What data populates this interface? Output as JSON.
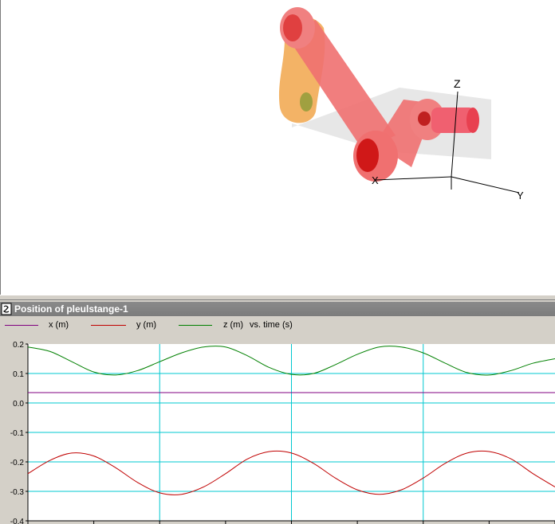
{
  "plot_window": {
    "title": "Position of pleulstange-1",
    "legend": [
      {
        "label": "x (m)",
        "color": "#800080"
      },
      {
        "label": "y (m)",
        "color": "#c00000"
      },
      {
        "label": "z (m)",
        "color": "#008000"
      }
    ],
    "legend_suffix": "vs. time (s)"
  },
  "viewport": {
    "axis_labels": {
      "z": "Z",
      "y": "Y",
      "x": "X"
    }
  },
  "chart_data": {
    "type": "line",
    "xlabel": "time (s)",
    "ylim": [
      -0.4,
      0.2
    ],
    "yticks": [
      "0.2",
      "0.1",
      "0.0",
      "-0.1",
      "-0.2",
      "-0.3",
      "-0.4"
    ],
    "ytick_values": [
      0.2,
      0.1,
      0.0,
      -0.1,
      -0.2,
      -0.3,
      -0.4
    ],
    "grid": true,
    "series": [
      {
        "name": "x (m)",
        "color": "#800080",
        "x": [
          0,
          1,
          2,
          3,
          4,
          5,
          6,
          7,
          8,
          9,
          10,
          11,
          12
        ],
        "values": [
          0.035,
          0.035,
          0.035,
          0.035,
          0.035,
          0.035,
          0.035,
          0.035,
          0.035,
          0.035,
          0.035,
          0.035,
          0.035
        ]
      },
      {
        "name": "y (m)",
        "color": "#c00000",
        "x": [
          0,
          0.5,
          1,
          1.5,
          2,
          2.5,
          3,
          3.5,
          4,
          4.5,
          5,
          5.5,
          6,
          6.5,
          7,
          7.5,
          8,
          8.5,
          9,
          9.5,
          10,
          10.5,
          11,
          11.5,
          12
        ],
        "values": [
          -0.24,
          -0.195,
          -0.17,
          -0.18,
          -0.22,
          -0.27,
          -0.305,
          -0.31,
          -0.285,
          -0.24,
          -0.19,
          -0.165,
          -0.17,
          -0.205,
          -0.255,
          -0.295,
          -0.31,
          -0.295,
          -0.255,
          -0.205,
          -0.17,
          -0.165,
          -0.19,
          -0.24,
          -0.285
        ]
      },
      {
        "name": "z (m)",
        "color": "#008000",
        "x": [
          0,
          0.5,
          1,
          1.5,
          2,
          2.5,
          3,
          3.5,
          4,
          4.5,
          5,
          5.5,
          6,
          6.5,
          7,
          7.5,
          8,
          8.5,
          9,
          9.5,
          10,
          10.5,
          11,
          11.5,
          12
        ],
        "values": [
          0.19,
          0.175,
          0.14,
          0.105,
          0.095,
          0.11,
          0.14,
          0.17,
          0.19,
          0.19,
          0.16,
          0.12,
          0.097,
          0.1,
          0.13,
          0.165,
          0.19,
          0.19,
          0.17,
          0.135,
          0.103,
          0.095,
          0.11,
          0.135,
          0.15
        ]
      }
    ]
  }
}
